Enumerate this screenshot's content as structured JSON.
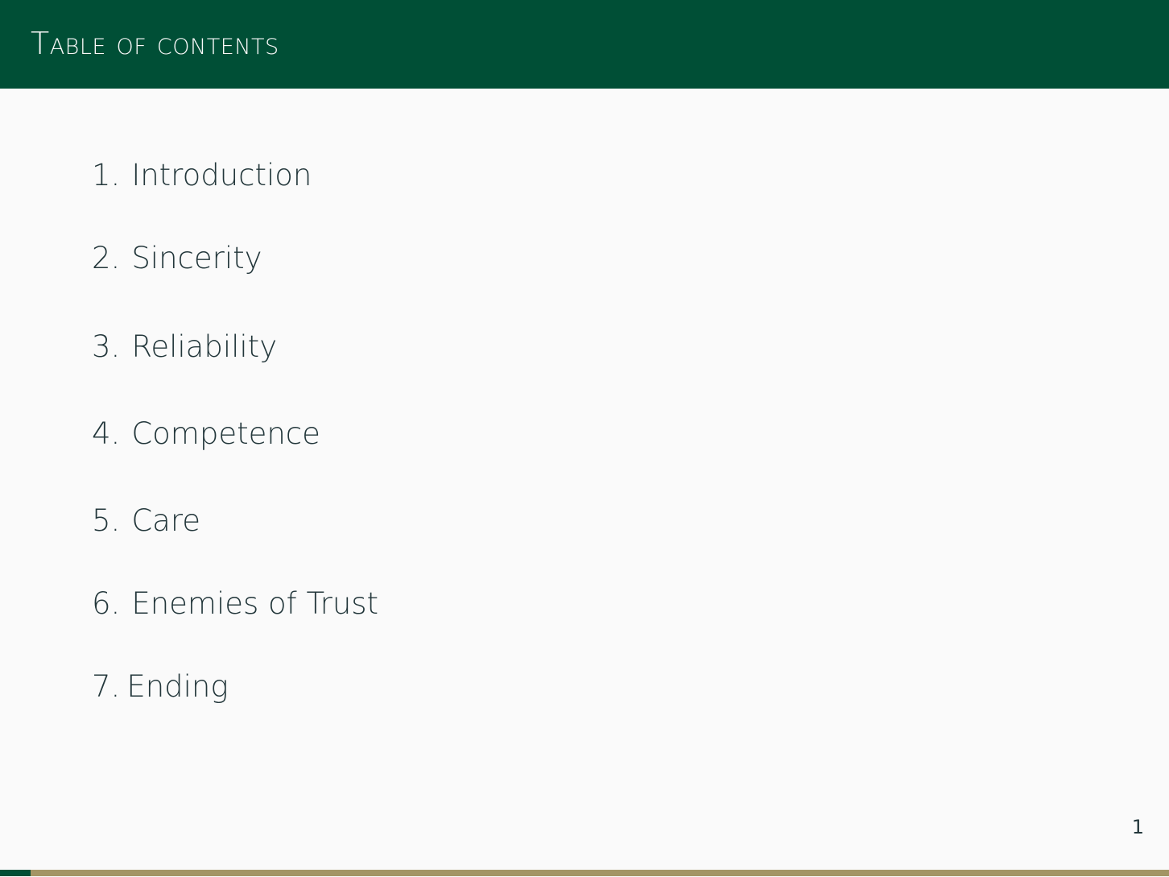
{
  "header": {
    "title": "Table of contents"
  },
  "toc": {
    "items": [
      {
        "number": "1.",
        "label": "Introduction"
      },
      {
        "number": "2.",
        "label": "Sincerity"
      },
      {
        "number": "3.",
        "label": "Reliability"
      },
      {
        "number": "4.",
        "label": "Competence"
      },
      {
        "number": "5.",
        "label": "Care"
      },
      {
        "number": "6.",
        "label": "Enemies of Trust"
      },
      {
        "number": "7.",
        "label": "Ending"
      }
    ]
  },
  "footer": {
    "page_number": "1",
    "progress_fraction": 0.026
  },
  "colors": {
    "header": "#004f36",
    "progress_fill": "#004f36",
    "progress_track": "#a39565",
    "background": "#fafafa",
    "text": "#23373b"
  }
}
